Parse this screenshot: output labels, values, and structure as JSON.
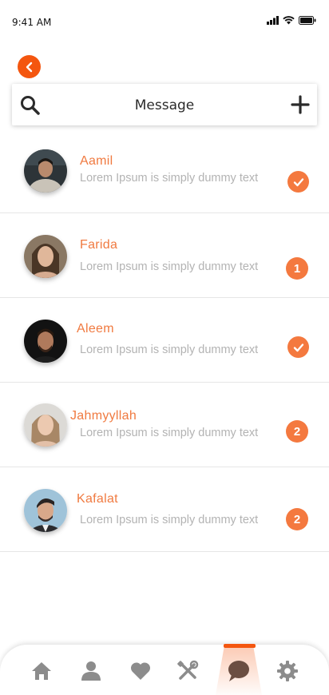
{
  "status": {
    "time": "9:41 AM"
  },
  "header": {
    "title": "Message"
  },
  "conversations": [
    {
      "name": "Aamil",
      "preview": "Lorem Ipsum is simply dummy text",
      "status": "read"
    },
    {
      "name": "Farida",
      "preview": "Lorem Ipsum is simply dummy text",
      "unread": "1"
    },
    {
      "name": "Aleem",
      "preview": "Lorem Ipsum is simply dummy text",
      "status": "read"
    },
    {
      "name": "Jahmyyllah",
      "preview": "Lorem Ipsum is simply dummy text",
      "unread": "2"
    },
    {
      "name": "Kafalat",
      "preview": "Lorem Ipsum is simply dummy text",
      "unread": "2"
    }
  ],
  "nav": {
    "items": [
      "home-icon",
      "profile-icon",
      "heart-icon",
      "tools-icon",
      "chat-icon",
      "gear-icon"
    ],
    "active": "chat-icon"
  },
  "colors": {
    "accent": "#f4560f",
    "badge": "#f4793f",
    "name": "#f07a40",
    "preview": "#b3b3b3"
  }
}
